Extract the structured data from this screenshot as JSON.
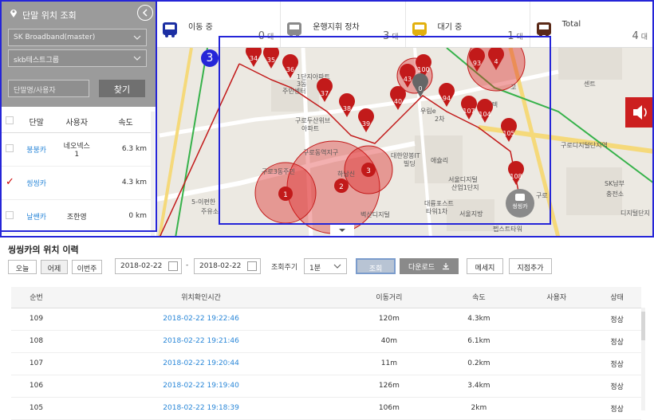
{
  "status": {
    "moving": {
      "label": "이동 중",
      "count": "0",
      "unit": "대",
      "color": "#1c2fa3"
    },
    "engine_off": {
      "label": "운행지휘 정차",
      "count": "3",
      "unit": "대",
      "color": "#8a8a8a"
    },
    "waiting": {
      "label": "대기 중",
      "count": "1",
      "unit": "대",
      "color": "#e2b00d"
    },
    "total": {
      "label": "Total",
      "count": "4",
      "unit": "대",
      "color": "#5b2a18"
    }
  },
  "panel": {
    "title": "단말 위치 조회",
    "company_select": "SK Broadband(master)",
    "group_select": "skb테스트그룹",
    "search_placeholder": "단말명/사용자",
    "search_button": "찾기",
    "columns": [
      "단말",
      "사용자",
      "속도"
    ],
    "rows": [
      {
        "name": "붕붕카",
        "user_line1": "네오넥스",
        "user_line2": "1",
        "speed": "6.3 km",
        "checked": false
      },
      {
        "name": "씽씽카",
        "user_line1": "",
        "user_line2": "",
        "speed": "4.3 km",
        "checked": true
      },
      {
        "name": "날쌘카",
        "user_line1": "조한영",
        "user_line2": "",
        "speed": "0 km",
        "checked": false
      }
    ]
  },
  "map": {
    "highlight_badge": "3",
    "vehicle_label": "씽씽카",
    "labels": [
      {
        "text": "1단지아파트"
      },
      {
        "text": "구로두산위브"
      },
      {
        "text": "아파트"
      },
      {
        "text": "대륭포스트"
      },
      {
        "text": "타워1차"
      },
      {
        "text": "서울디지털"
      },
      {
        "text": "산업1단지"
      },
      {
        "text": "애슐리"
      },
      {
        "text": "서울지방"
      },
      {
        "text": "벽산디지털"
      },
      {
        "text": "SK남부"
      },
      {
        "text": "충전소"
      },
      {
        "text": "디지털단지"
      },
      {
        "text": "5-이편한"
      },
      {
        "text": "주유소"
      },
      {
        "text": "우림e"
      },
      {
        "text": "2차"
      },
      {
        "text": "구로동역지구"
      },
      {
        "text": "하남신"
      },
      {
        "text": "대한양봉IT"
      },
      {
        "text": "빌딩"
      },
      {
        "text": "엠비텍"
      },
      {
        "text": "고"
      },
      {
        "text": "구로3동주민"
      },
      {
        "text": "3동"
      },
      {
        "text": "주민센터"
      },
      {
        "text": "구로"
      },
      {
        "text": "구로디지털단지역"
      },
      {
        "text": "펩스트타워"
      },
      {
        "text": "센트"
      }
    ],
    "markers": [
      {
        "n": "34"
      },
      {
        "n": "35"
      },
      {
        "n": "36"
      },
      {
        "n": "37"
      },
      {
        "n": "38"
      },
      {
        "n": "39"
      },
      {
        "n": "40"
      },
      {
        "n": "43"
      },
      {
        "n": "100"
      },
      {
        "n": "0"
      },
      {
        "n": "94"
      },
      {
        "n": "93"
      },
      {
        "n": "4"
      },
      {
        "n": "107"
      },
      {
        "n": "104"
      },
      {
        "n": "105"
      },
      {
        "n": "108"
      },
      {
        "n": "1"
      },
      {
        "n": "2"
      },
      {
        "n": "3"
      }
    ]
  },
  "history": {
    "title": "씽씽카의 위치 이력",
    "range_buttons": [
      "오늘",
      "어제",
      "이번주"
    ],
    "date_from": "2018-02-22",
    "date_sep": "-",
    "date_to": "2018-02-22",
    "cycle_label": "조회주기",
    "cycle_value": "1분",
    "search_button": "조회",
    "download_button": "다운로드",
    "message_button": "메세지",
    "add_point_button": "지점추가",
    "columns": [
      "순번",
      "위치확인시간",
      "이동거리",
      "속도",
      "사용자",
      "상태"
    ],
    "rows": [
      {
        "seq": "109",
        "time": "2018-02-22 19:22:46",
        "distance": "120m",
        "speed": "4.3km",
        "user": "",
        "status": "정상"
      },
      {
        "seq": "108",
        "time": "2018-02-22 19:21:46",
        "distance": "40m",
        "speed": "6.1km",
        "user": "",
        "status": "정상"
      },
      {
        "seq": "107",
        "time": "2018-02-22 19:20:44",
        "distance": "11m",
        "speed": "0.2km",
        "user": "",
        "status": "정상"
      },
      {
        "seq": "106",
        "time": "2018-02-22 19:19:40",
        "distance": "126m",
        "speed": "3.4km",
        "user": "",
        "status": "정상"
      },
      {
        "seq": "105",
        "time": "2018-02-22 19:18:39",
        "distance": "106m",
        "speed": "2km",
        "user": "",
        "status": "정상"
      }
    ]
  }
}
